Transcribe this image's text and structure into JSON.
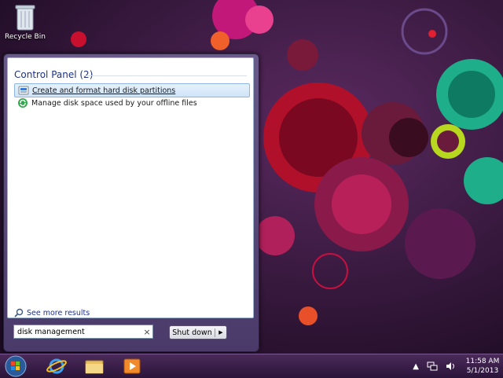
{
  "desktop": {
    "recycle_bin_label": "Recycle Bin"
  },
  "start_menu": {
    "group_header": "Control Panel (2)",
    "results": [
      {
        "label": "Create and format hard disk partitions",
        "icon": "disk-management-icon",
        "selected": true
      },
      {
        "label": "Manage disk space used by your offline files",
        "icon": "sync-center-icon",
        "selected": false
      }
    ],
    "see_more_label": "See more results",
    "search": {
      "value": "disk management",
      "clear_icon": "×"
    },
    "shutdown": {
      "label": "Shut down",
      "arrow": "▶"
    }
  },
  "taskbar": {
    "pinned": [
      {
        "name": "internet-explorer",
        "icon": "ie-icon"
      },
      {
        "name": "windows-explorer",
        "icon": "folder-icon"
      },
      {
        "name": "media-player",
        "icon": "media-player-icon"
      }
    ],
    "tray": {
      "expand_icon": "▲",
      "time": "11:58 AM",
      "date": "5/1/2013"
    }
  },
  "colors": {
    "accent": "#1e3287",
    "wallpaper_base": "#2a1230",
    "selection": "#cfe4f8"
  }
}
